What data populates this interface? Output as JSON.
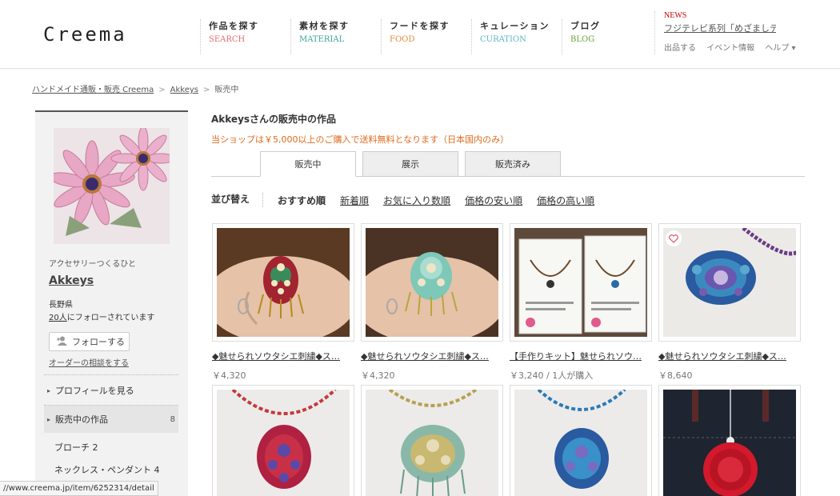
{
  "header": {
    "logo": "Creema",
    "nav": [
      {
        "jp": "作品を探す",
        "en": "SEARCH",
        "color": "#e86a6a"
      },
      {
        "jp": "素材を探す",
        "en": "MATERIAL",
        "color": "#3aa39a"
      },
      {
        "jp": "フードを探す",
        "en": "FOOD",
        "color": "#e0893a"
      },
      {
        "jp": "キュレーション",
        "en": "CURATION",
        "color": "#5bb6c4"
      },
      {
        "jp": "ブログ",
        "en": "BLOG",
        "color": "#6aa33a"
      }
    ],
    "news_label": "NEWS",
    "news_text": "フジテレビ系列「めざましテ",
    "sub_links": [
      "出品する",
      "イベント情報",
      "ヘルプ ▾"
    ]
  },
  "breadcrumb": {
    "items": [
      "ハンドメイド通販・販売 Creema",
      "Akkeys",
      "販売中"
    ],
    "sep": ">"
  },
  "sidebar": {
    "tagline": "アクセサリーつくるひと",
    "name": "Akkeys",
    "prefecture": "長野県",
    "followers_count": "20人",
    "followers_suffix": "にフォローされています",
    "follow_label": "フォローする",
    "order_label": "オーダーの相談をする",
    "menu": [
      {
        "label": "プロフィールを見る",
        "count": ""
      },
      {
        "label": "販売中の作品",
        "count": "8"
      }
    ],
    "sub_items": [
      "ブローチ  2",
      "ネックレス・ペンダント  4"
    ]
  },
  "main": {
    "title": "Akkeysさんの販売中の作品",
    "shipping_note": "当ショップは￥5,000以上のご購入で送料無料となります（日本国内のみ）",
    "tabs": [
      "販売中",
      "展示",
      "販売済み"
    ],
    "sort_label": "並び替え",
    "sort_options": [
      "おすすめ順",
      "新着順",
      "お気に入り数順",
      "価格の安い順",
      "価格の高い順"
    ],
    "products": [
      {
        "title": "◆魅せられソウタシエ刺繍◆ス…",
        "price": "￥4,320"
      },
      {
        "title": "◆魅せられソウタシエ刺繍◆ス…",
        "price": "￥4,320"
      },
      {
        "title": "【手作りキット】魅せられソウ…",
        "price": "￥3,240 / 1人が購入"
      },
      {
        "title": "◆魅せられソウタシエ刺繍◆ス…",
        "price": "￥8,640"
      },
      {
        "title": "",
        "price": ""
      },
      {
        "title": "",
        "price": ""
      },
      {
        "title": "",
        "price": ""
      },
      {
        "title": "",
        "price": ""
      }
    ]
  },
  "statusbar": {
    "url": "//www.creema.jp/item/6252314/detail"
  },
  "colors": {
    "accent_orange": "#e06b1c",
    "news_red": "#cc0000"
  }
}
